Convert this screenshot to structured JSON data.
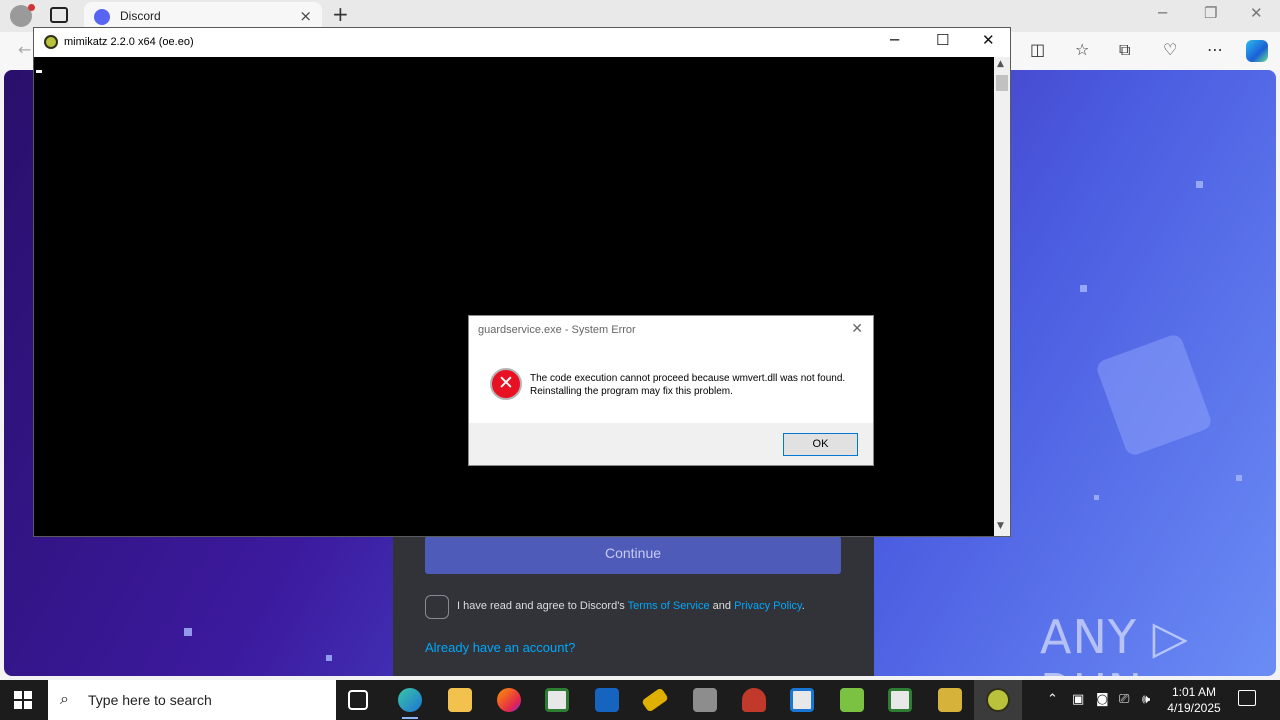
{
  "browser": {
    "tab_title": "Discord",
    "new_tab_symbol": "+",
    "close_tab_symbol": "×"
  },
  "discord": {
    "continue_label": "Continue",
    "agree_prefix": "I have read and agree to Discord's ",
    "terms_label": "Terms of Service",
    "agree_and": " and ",
    "privacy_label": "Privacy Policy",
    "agree_suffix": ".",
    "already_label": "Already have an account?"
  },
  "watermark": "ANY ▷ RUN",
  "console": {
    "title": "mimikatz 2.2.0 x64 (oe.eo)"
  },
  "dialog": {
    "title": "guardservice.exe - System Error",
    "message": "The code execution cannot proceed because wmvert.dll was not found. Reinstalling the program may fix this problem.",
    "ok_label": "OK"
  },
  "taskbar": {
    "search_placeholder": "Type here to search",
    "time": "1:01 AM",
    "date": "4/19/2025"
  },
  "colors": {
    "discord_blurple": "#5865f2",
    "error_red": "#e81123",
    "link_blue": "#00a8fc"
  }
}
